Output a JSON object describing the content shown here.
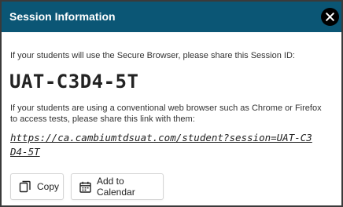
{
  "dialog": {
    "title": "Session Information",
    "close_icon": "close-icon",
    "instruction_secure": "If your students will use the Secure Browser, please share this Session ID:",
    "session_id": "UAT-C3D4-5T",
    "instruction_browser": "If your students are using a conventional web browser such as Chrome or Firefox to access tests, please share this link with them:",
    "session_link": "https://ca.cambiumtdsuat.com/student?session=UAT-C3D4-5T"
  },
  "actions": {
    "copy_label": "Copy",
    "copy_icon": "copy-icon",
    "calendar_label": "Add to Calendar",
    "calendar_icon": "calendar-icon"
  },
  "colors": {
    "header_bg": "#0b5675",
    "header_text": "#ffffff",
    "body_text": "#333333",
    "border": "#3a3a3a"
  }
}
